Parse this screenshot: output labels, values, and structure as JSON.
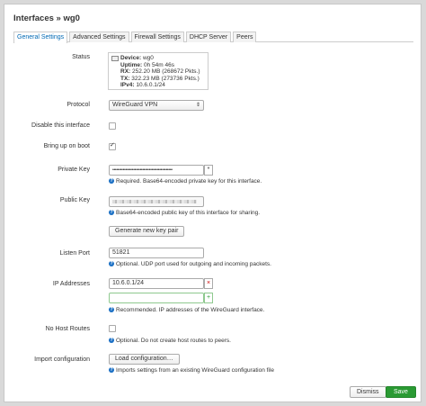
{
  "title": "Interfaces » wg0",
  "tabs": [
    "General Settings",
    "Advanced Settings",
    "Firewall Settings",
    "DHCP Server",
    "Peers"
  ],
  "status": {
    "label": "Status",
    "device": "wg0",
    "uptime": "0h 54m 46s",
    "rx": "252.20 MB (268672 Pkts.)",
    "tx": "322.23 MB (273736 Pkts.)",
    "ipv4": "10.6.0.1/24",
    "k_device": "Device:",
    "k_uptime": "Uptime:",
    "k_rx": "RX:",
    "k_tx": "TX:",
    "k_ipv4": "IPv4:"
  },
  "protocol": {
    "label": "Protocol",
    "value": "WireGuard VPN"
  },
  "disable": {
    "label": "Disable this interface"
  },
  "boot": {
    "label": "Bring up on boot"
  },
  "privkey": {
    "label": "Private Key",
    "value": "••••••••••••••••••••••••••••••••••••••••••••••",
    "help": "Required. Base64-encoded private key for this interface."
  },
  "pubkey": {
    "label": "Public Key",
    "help": "Base64-encoded public key of this interface for sharing."
  },
  "genkey": "Generate new key pair",
  "port": {
    "label": "Listen Port",
    "value": "51821",
    "help": "Optional. UDP port used for outgoing and incoming packets."
  },
  "ip": {
    "label": "IP Addresses",
    "value": "10.6.0.1/24",
    "help": "Recommended. IP addresses of the WireGuard interface."
  },
  "nohost": {
    "label": "No Host Routes",
    "help": "Optional. Do not create host routes to peers."
  },
  "import": {
    "label": "Import configuration",
    "button": "Load configuration…",
    "help": "Imports settings from an existing WireGuard configuration file"
  },
  "footer": {
    "dismiss": "Dismiss",
    "save": "Save"
  },
  "colors": {
    "save": "#2a9a33",
    "tab_active": "#0069b4",
    "help_icon": "#1a6fc4"
  }
}
